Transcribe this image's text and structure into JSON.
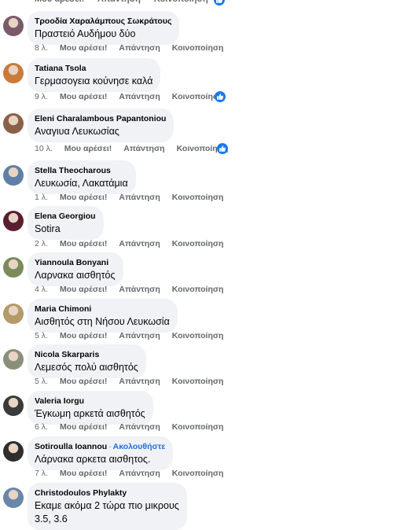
{
  "actions": {
    "like": "Μου αρέσει!",
    "reply": "Απάντηση",
    "share": "Κοινοποίηση"
  },
  "comments": [
    {
      "name": "Τροοδία Χαραλάμπους Σωκράτους",
      "text": "Πραστειό Αυδήμου δύο",
      "time": "8 λ.",
      "liked": false,
      "avatar_color": "#7a5a6a"
    },
    {
      "name": "Tatiana Tsola",
      "text": "Γερμασογεια κούνησε καλά",
      "time": "9 λ.",
      "liked": true,
      "avatar_color": "#c87b3a"
    },
    {
      "name": "Eleni Charalambous Papantoniou",
      "text": "Αναγιυα Λευκωσίας",
      "time": "10 λ.",
      "liked": true,
      "avatar_color": "#8a6048"
    },
    {
      "name": "Stella Theocharous",
      "text": "Λευκωσία, Λακατάμια",
      "time": "1 λ.",
      "liked": false,
      "avatar_color": "#5e7fa6"
    },
    {
      "name": "Elena Georgiou",
      "text": "Sotira",
      "time": "2 λ.",
      "liked": false,
      "avatar_color": "#5a1f2e"
    },
    {
      "name": "Yiannoula Bonyani",
      "text": "Λαρνακα αισθητός",
      "time": "4 λ.",
      "liked": false,
      "avatar_color": "#7b8a5a"
    },
    {
      "name": "Maria Chimoni",
      "text": "Αισθητός στη Νήσου Λευκωσία",
      "time": "5 λ.",
      "liked": false,
      "avatar_color": "#b59a6a"
    },
    {
      "name": "Nicola Skarparis",
      "text": "Λεμεσός πολύ αισθητός",
      "time": "5 λ.",
      "liked": false,
      "avatar_color": "#8a8f7a"
    },
    {
      "name": "Valeria Iorgu",
      "text": "Έγκωμη αρκετά αισθητός",
      "time": "6 λ.",
      "liked": false,
      "avatar_color": "#3a3a3a"
    },
    {
      "name": "Sotiroulla Ioannou",
      "follow": "Ακολουθήστε",
      "text": "Λάρνακα αρκετα αισθητος.",
      "time": "7 λ.",
      "liked": false,
      "avatar_color": "#2e2e2e"
    },
    {
      "name": "Christodoulos Phylakty",
      "text": "Εκαμε ακόμα 2 τώρα πιο μικρους",
      "text2": "3.5, 3.6",
      "time": "",
      "liked": false,
      "avatar_color": "#6a86a8"
    }
  ]
}
